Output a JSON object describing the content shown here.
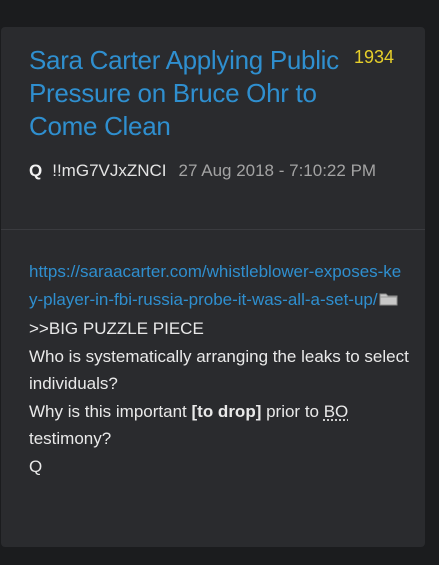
{
  "post": {
    "title": "Sara Carter Applying Public Pressure on Bruce Ohr to Come Clean",
    "number": "1934",
    "author": "Q",
    "tripcode": "!!mG7VJxZNCI",
    "timestamp": "27 Aug 2018 - 7:10:22 PM",
    "link": "https://saraacarter.com/whistleblower-exposes-key-player-in-fbi-russia-probe-it-was-all-a-set-up/",
    "folder_icon": "folder-icon",
    "lines": {
      "l1": ">>BIG PUZZLE PIECE",
      "l2": "Who is systematically arranging the leaks to select individuals?",
      "l3_pre": "Why is this important ",
      "l3_bold": "[to drop]",
      "l3_mid": " prior to ",
      "l3_abbr": "BO",
      "l3_post": " testimony?",
      "l4": "Q"
    }
  },
  "colors": {
    "background": "#1b1c1e",
    "card": "#2a2b2e",
    "title": "#2f8fcf",
    "number": "#e6cf2a",
    "link": "#2f8fcf"
  }
}
